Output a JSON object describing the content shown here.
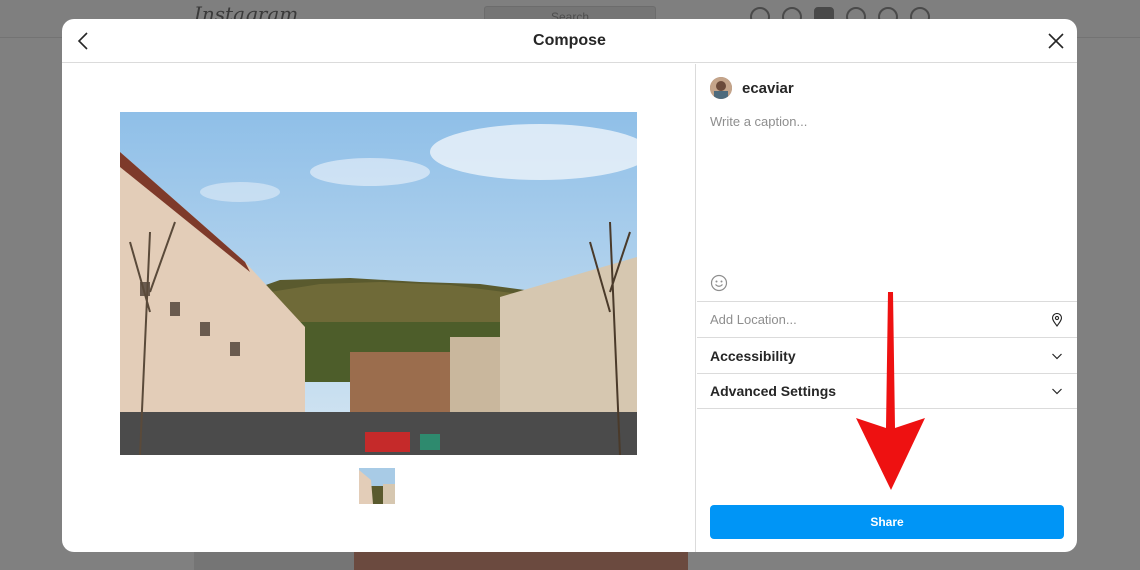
{
  "background": {
    "logo": "Instagram",
    "search_placeholder": "Search"
  },
  "modal": {
    "title": "Compose",
    "back_icon": "chevron-left-icon",
    "close_icon": "close-icon"
  },
  "composer": {
    "username": "ecaviar",
    "caption_placeholder": "Write a caption...",
    "location_placeholder": "Add Location...",
    "accessibility_label": "Accessibility",
    "advanced_label": "Advanced Settings",
    "share_label": "Share"
  },
  "colors": {
    "accent": "#0095f6",
    "annotation_arrow": "#ee1111"
  }
}
